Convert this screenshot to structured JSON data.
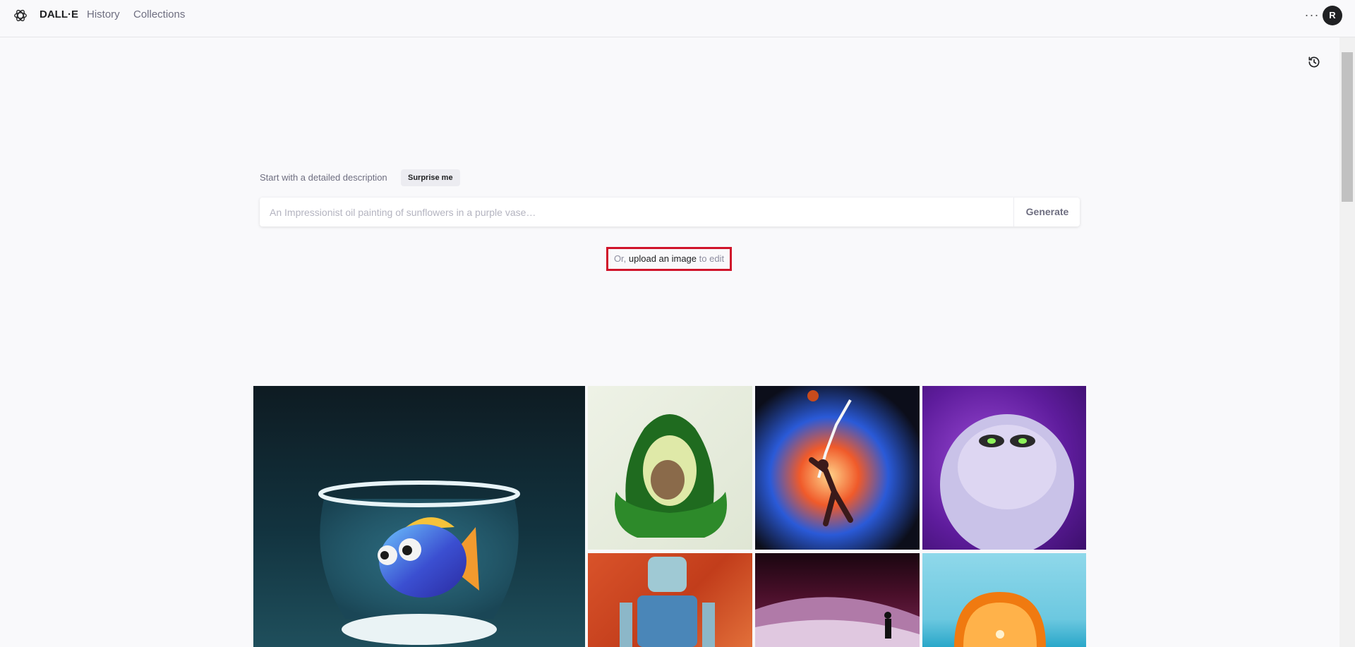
{
  "header": {
    "brand": "DALL·E",
    "nav": {
      "history": "History",
      "collections": "Collections"
    },
    "more": "···",
    "avatar_initial": "R"
  },
  "prompt": {
    "label": "Start with a detailed description",
    "surprise": "Surprise me",
    "placeholder": "An Impressionist oil painting of sunflowers in a purple vase…",
    "value": "",
    "generate": "Generate"
  },
  "upload": {
    "prefix": "Or, ",
    "link": "upload an image",
    "suffix": " to edit"
  },
  "gallery": [
    {
      "name": "fishbowl-image",
      "subject": "fish in a fishbowl"
    },
    {
      "name": "avocado-chair-image",
      "subject": "avocado armchair"
    },
    {
      "name": "space-basketball-image",
      "subject": "basketball dunk in space painting"
    },
    {
      "name": "purple-monster-image",
      "subject": "purple furry monster"
    },
    {
      "name": "robot-painting-image",
      "subject": "robot oil painting"
    },
    {
      "name": "desert-figure-image",
      "subject": "figure in surreal landscape"
    },
    {
      "name": "orange-image",
      "subject": "orange half on blue"
    }
  ],
  "colors": {
    "background": "#f9f9fb",
    "highlight_border": "#d0142a",
    "text_primary": "#202123",
    "text_muted": "#6e6e80"
  }
}
